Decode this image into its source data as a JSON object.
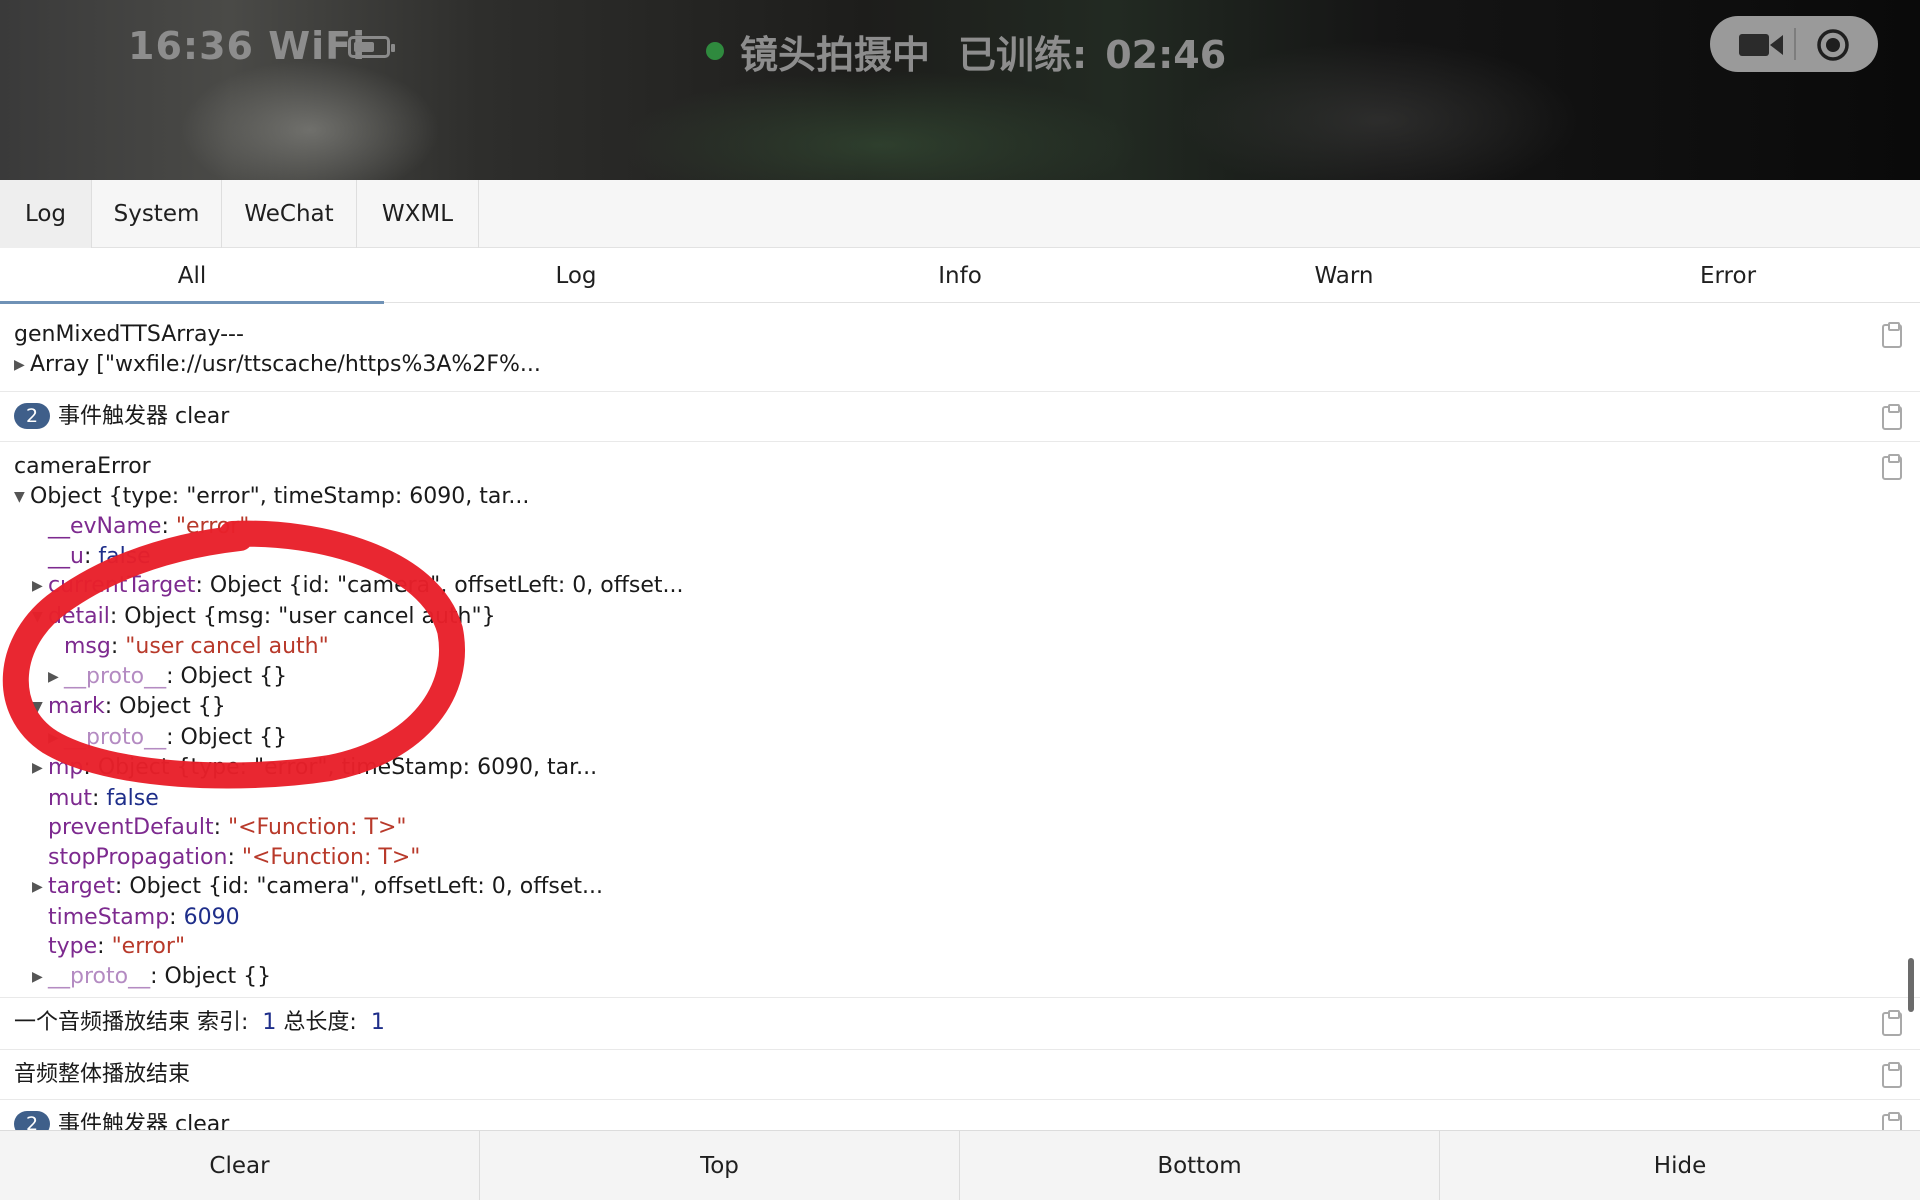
{
  "status_bar": {
    "time_wifi": "16:36 WiFi",
    "recording_label": "镜头拍摄中",
    "trained_label": "已训练:",
    "trained_time": "02:46"
  },
  "tabs": [
    {
      "label": "Log"
    },
    {
      "label": "System"
    },
    {
      "label": "WeChat"
    },
    {
      "label": "WXML"
    }
  ],
  "filters": [
    {
      "label": "All"
    },
    {
      "label": "Log"
    },
    {
      "label": "Info"
    },
    {
      "label": "Warn"
    },
    {
      "label": "Error"
    }
  ],
  "log": {
    "entry1": {
      "title": "genMixedTTSArray---",
      "summary": "Array [\"wxfile://usr/ttscache/https%3A%2F%..."
    },
    "entry2": {
      "count": "2",
      "text": "事件触发器 clear"
    },
    "entry3": {
      "title": "cameraError",
      "summary": "Object {type: \"error\", timeStamp: 6090, tar...",
      "evName_key": "__evName",
      "evName_val": "\"error\"",
      "u_key": "__u",
      "u_val": "false",
      "currentTarget_key": "currentTarget",
      "currentTarget_val": "Object {id: \"camera\", offsetLeft: 0, offset...",
      "detail_key": "detail",
      "detail_val": "Object {msg: \"user cancel auth\"}",
      "msg_key": "msg",
      "msg_val": "\"user cancel auth\"",
      "proto_key": "__proto__",
      "proto_val": "Object {}",
      "mark_key": "mark",
      "mark_val": "Object {}",
      "mp_key": "mp",
      "mp_val": "Object {type: \"error\", timeStamp: 6090, tar...",
      "mut_key": "mut",
      "mut_val": "false",
      "preventDefault_key": "preventDefault",
      "preventDefault_val": "\"<Function: T>\"",
      "stopPropagation_key": "stopPropagation",
      "stopPropagation_val": "\"<Function: T>\"",
      "target_key": "target",
      "target_val": "Object {id: \"camera\", offsetLeft: 0, offset...",
      "timeStamp_key": "timeStamp",
      "timeStamp_val": "6090",
      "type_key": "type",
      "type_val": "\"error\""
    },
    "entry4": {
      "text1": "一个音频播放结束 索引:",
      "index": "1",
      "text2": "总长度:",
      "total": "1"
    },
    "entry5": {
      "text": "音频整体播放结束"
    },
    "entry6": {
      "count": "2",
      "text": "事件触发器 clear"
    }
  },
  "bottom_bar": {
    "clear": "Clear",
    "top": "Top",
    "bottom": "Bottom",
    "hide": "Hide"
  },
  "colors": {
    "badge": "#3f5f8a",
    "active_filter_underline": "#6f92b6",
    "annotation": "#e8202a",
    "key": "#7d2a8f",
    "string": "#b8392a",
    "number": "#1e2e8a"
  }
}
